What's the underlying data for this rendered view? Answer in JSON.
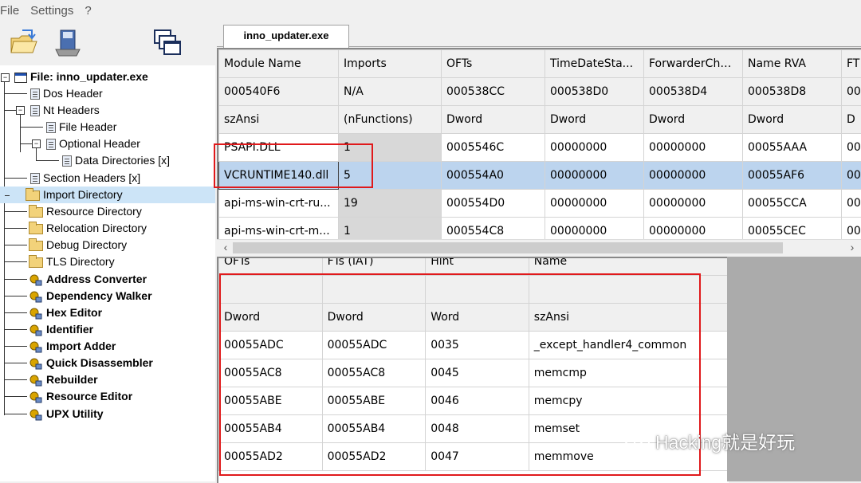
{
  "menu": {
    "items": [
      "File",
      "Settings",
      "?"
    ]
  },
  "tab": {
    "label": "inno_updater.exe"
  },
  "tree": {
    "root": "File: inno_updater.exe",
    "items": [
      {
        "label": "Dos Header"
      },
      {
        "label": "Nt Headers"
      },
      {
        "label": "File Header"
      },
      {
        "label": "Optional Header"
      },
      {
        "label": "Data Directories [x]"
      },
      {
        "label": "Section Headers [x]"
      },
      {
        "label": "Import Directory"
      },
      {
        "label": "Resource Directory"
      },
      {
        "label": "Relocation Directory"
      },
      {
        "label": "Debug Directory"
      },
      {
        "label": "TLS Directory"
      },
      {
        "label": "Address Converter"
      },
      {
        "label": "Dependency Walker"
      },
      {
        "label": "Hex Editor"
      },
      {
        "label": "Identifier"
      },
      {
        "label": "Import Adder"
      },
      {
        "label": "Quick Disassembler"
      },
      {
        "label": "Rebuilder"
      },
      {
        "label": "Resource Editor"
      },
      {
        "label": "UPX Utility"
      }
    ]
  },
  "imports_table": {
    "columns": [
      "Module Name",
      "Imports",
      "OFTs",
      "TimeDateSta...",
      "ForwarderCha...",
      "Name RVA",
      "FT"
    ],
    "offset_row": [
      "000540F6",
      "N/A",
      "000538CC",
      "000538D0",
      "000538D4",
      "000538D8",
      "00"
    ],
    "type_row": [
      "szAnsi",
      "(nFunctions)",
      "Dword",
      "Dword",
      "Dword",
      "Dword",
      "D"
    ],
    "rows": [
      [
        "PSAPI.DLL",
        "1",
        "0005546C",
        "00000000",
        "00000000",
        "00055AAA",
        "00"
      ],
      [
        "VCRUNTIME140.dll",
        "5",
        "000554A0",
        "00000000",
        "00000000",
        "00055AF6",
        "00"
      ],
      [
        "api-ms-win-crt-ru...",
        "19",
        "000554D0",
        "00000000",
        "00000000",
        "00055CCA",
        "00"
      ],
      [
        "api-ms-win-crt-m...",
        "1",
        "000554C8",
        "00000000",
        "00000000",
        "00055CEC",
        "00"
      ]
    ]
  },
  "functions_table": {
    "columns": [
      "OFTs",
      "FTs (IAT)",
      "Hint",
      "Name"
    ],
    "blank_row": [
      "",
      "",
      "",
      ""
    ],
    "type_row": [
      "Dword",
      "Dword",
      "Word",
      "szAnsi"
    ],
    "rows": [
      [
        "00055ADC",
        "00055ADC",
        "0035",
        "_except_handler4_common"
      ],
      [
        "00055AC8",
        "00055AC8",
        "0045",
        "memcmp"
      ],
      [
        "00055ABE",
        "00055ABE",
        "0046",
        "memcpy"
      ],
      [
        "00055AB4",
        "00055AB4",
        "0048",
        "memset"
      ],
      [
        "00055AD2",
        "00055AD2",
        "0047",
        "memmove"
      ]
    ]
  },
  "watermark": {
    "text": "Hacking就是好玩"
  },
  "colors": {
    "highlight": "#e0191b",
    "selection": "#bcd4ee",
    "tree_selection": "#cce4f7"
  }
}
